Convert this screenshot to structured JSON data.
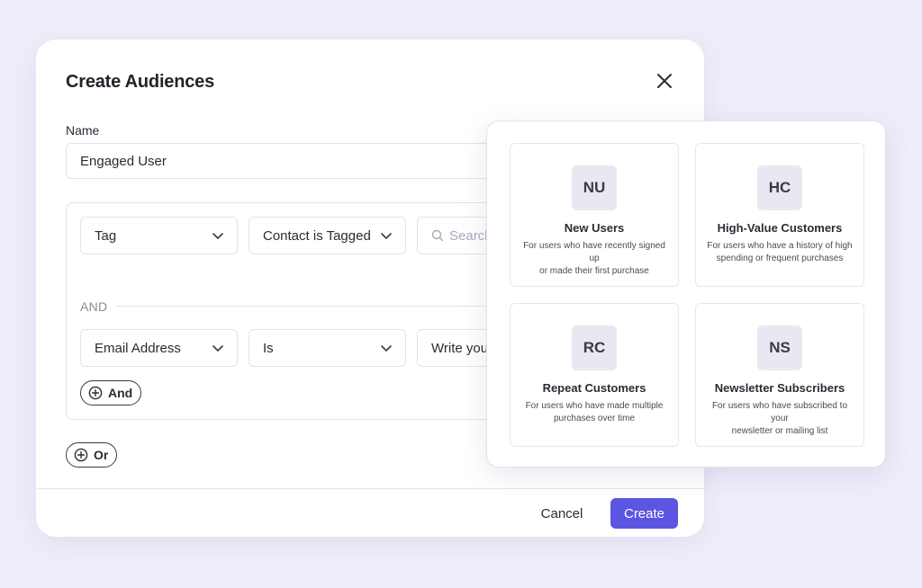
{
  "modal": {
    "title": "Create Audiences",
    "name_label": "Name",
    "name_value": "Engaged User",
    "rules": {
      "row1": {
        "field": "Tag",
        "operator": "Contact is Tagged",
        "value_placeholder": "Search"
      },
      "connector": "AND",
      "row2": {
        "field": "Email Address",
        "operator": "Is",
        "value_placeholder": "Write you"
      },
      "and_button": "And"
    },
    "or_button": "Or",
    "footer": {
      "cancel": "Cancel",
      "create": "Create"
    }
  },
  "templates": [
    {
      "badge": "NU",
      "title": "New Users",
      "desc_line1": "For users who have recently signed up",
      "desc_line2": "or made their first purchase"
    },
    {
      "badge": "HC",
      "title": "High-Value Customers",
      "desc_line1": "For users who have a history of high",
      "desc_line2": "spending or frequent purchases"
    },
    {
      "badge": "RC",
      "title": "Repeat Customers",
      "desc_line1": "For users who have made multiple",
      "desc_line2": "purchases over time"
    },
    {
      "badge": "NS",
      "title": "Newsletter Subscribers",
      "desc_line1": "For users who have subscribed to your",
      "desc_line2": "newsletter or mailing list"
    }
  ],
  "icons": {
    "close": "close-icon",
    "dropdown": "chevron-down-icon",
    "search": "search-icon",
    "add": "plus-circle-icon"
  },
  "colors": {
    "background": "#eeeefa",
    "primary": "#5b55e2",
    "badge_bg": "#e8e8f2"
  }
}
